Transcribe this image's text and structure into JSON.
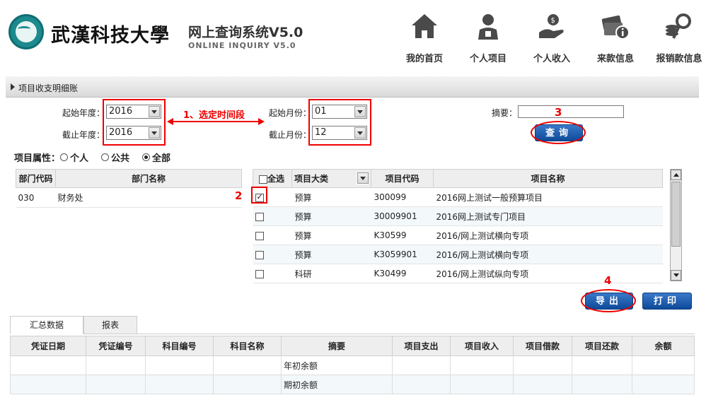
{
  "header": {
    "university": "武漢科技大學",
    "system_title": "网上查询系统V5.0",
    "system_subtitle": "ONLINE INQUIRY V5.0"
  },
  "nav": [
    {
      "label": "我的首页",
      "icon": "home-icon"
    },
    {
      "label": "个人项目",
      "icon": "person-icon"
    },
    {
      "label": "个人收入",
      "icon": "income-icon"
    },
    {
      "label": "来款信息",
      "icon": "money-info-icon"
    },
    {
      "label": "报销款信息",
      "icon": "reimburse-search-icon"
    }
  ],
  "section_title": "项目收支明细账",
  "form": {
    "start_year_label": "起始年度：",
    "start_year": "2016",
    "end_year_label": "截止年度：",
    "end_year": "2016",
    "start_month_label": "起始月份：",
    "start_month": "01",
    "end_month_label": "截止月份：",
    "end_month": "12",
    "summary_label": "摘要：",
    "summary_value": "",
    "query_button": "查询",
    "export_button": "导出",
    "print_button": "打印"
  },
  "annotations": {
    "step1": "1、选定时间段",
    "step2": "2",
    "step3": "3",
    "step4": "4"
  },
  "attr": {
    "label": "项目属性：",
    "options": [
      "个人",
      "公共",
      "全部"
    ],
    "selected": "全部"
  },
  "dept_table": {
    "headers": [
      "部门代码",
      "部门名称"
    ],
    "rows": [
      [
        "030",
        "财务处"
      ]
    ]
  },
  "proj_table": {
    "select_all": "全选",
    "headers": [
      "项目大类",
      "项目代码",
      "项目名称"
    ],
    "rows": [
      {
        "checked": true,
        "type": "预算",
        "code": "300099",
        "name": "2016网上测试一般预算项目"
      },
      {
        "checked": false,
        "type": "预算",
        "code": "30009901",
        "name": "2016网上测试专门项目"
      },
      {
        "checked": false,
        "type": "预算",
        "code": "K30599",
        "name": "2016/网上测试横向专项"
      },
      {
        "checked": false,
        "type": "预算",
        "code": "K3059901",
        "name": "2016/网上测试横向专项"
      },
      {
        "checked": false,
        "type": "科研",
        "code": "K30499",
        "name": "2016/网上测试纵向专项"
      }
    ]
  },
  "tabs": [
    "汇总数据",
    "报表"
  ],
  "summary_table": {
    "headers": [
      "凭证日期",
      "凭证编号",
      "科目编号",
      "科目名称",
      "摘要",
      "项目支出",
      "项目收入",
      "项目借款",
      "项目还款",
      "余额"
    ],
    "rows": [
      [
        "",
        "",
        "",
        "",
        "年初余额",
        "",
        "",
        "",
        "",
        ""
      ],
      [
        "",
        "",
        "",
        "",
        "期初余额",
        "",
        "",
        "",
        "",
        ""
      ]
    ]
  },
  "colors": {
    "accent_blue": "#0e4a9a",
    "annotation_red": "#ee0000",
    "logo_teal": "#1d8a8e"
  }
}
